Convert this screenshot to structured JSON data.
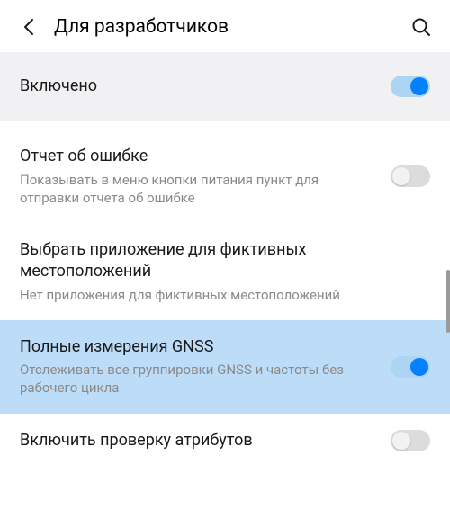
{
  "header": {
    "title": "Для разработчиков"
  },
  "rows": {
    "enabled": {
      "title": "Включено",
      "on": true
    },
    "bugreport": {
      "title": "Отчет об ошибке",
      "sub": "Показывать в меню кнопки питания пункт для отправки отчета об ошибке",
      "on": false
    },
    "mocklocation": {
      "title": "Выбрать приложение для фиктивных местоположений",
      "sub": "Нет приложения для фиктивных местоположений"
    },
    "gnss": {
      "title": "Полные измерения GNSS",
      "sub": "Отслеживать все группировки GNSS и частоты без рабочего цикла",
      "on": true
    },
    "attrcheck": {
      "title": "Включить проверку атрибутов",
      "on": false
    }
  }
}
